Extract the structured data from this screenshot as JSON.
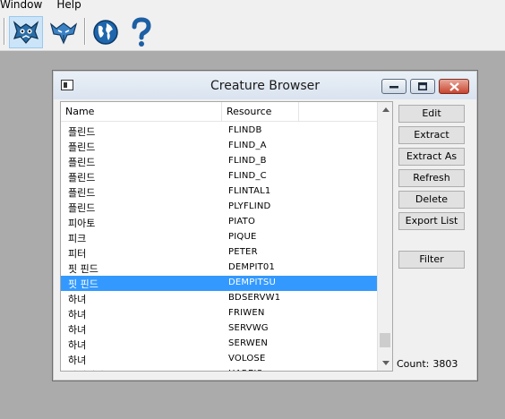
{
  "menu": [
    "Window",
    "Help"
  ],
  "toolbar": {
    "buttons": [
      "creature-icon",
      "batch-creature-icon",
      "globe-icon",
      "help-question-icon"
    ]
  },
  "window": {
    "title": "Creature Browser",
    "columns": [
      "Name",
      "Resource"
    ],
    "rows": [
      {
        "name": "플린드",
        "resource": "FLINDB"
      },
      {
        "name": "플린드",
        "resource": "FLIND_A"
      },
      {
        "name": "플린드",
        "resource": "FLIND_B"
      },
      {
        "name": "플린드",
        "resource": "FLIND_C"
      },
      {
        "name": "플린드",
        "resource": "FLINTAL1"
      },
      {
        "name": "플린드",
        "resource": "PLYFLIND"
      },
      {
        "name": "피아토",
        "resource": "PIATO"
      },
      {
        "name": "피크",
        "resource": "PIQUE"
      },
      {
        "name": "피터",
        "resource": "PETER"
      },
      {
        "name": "핏 핀드",
        "resource": "DEMPIT01"
      },
      {
        "name": "핏 핀드",
        "resource": "DEMPITSU",
        "selected": true
      },
      {
        "name": "하녀",
        "resource": "BDSERVW1"
      },
      {
        "name": "하녀",
        "resource": "FRIWEN"
      },
      {
        "name": "하녀",
        "resource": "SERVWG"
      },
      {
        "name": "하녀",
        "resource": "SERWEN"
      },
      {
        "name": "하녀",
        "resource": "VOLOSE"
      },
      {
        "name": "하레이샤",
        "resource": "HAREIS"
      }
    ],
    "buttons": {
      "edit": "Edit",
      "extract": "Extract",
      "extract_as": "Extract As",
      "refresh": "Refresh",
      "delete": "Delete",
      "export_list": "Export List",
      "filter": "Filter"
    },
    "count_label": "Count:",
    "count_value": "3803"
  },
  "colors": {
    "selection": "#3399ff",
    "annotation_underline": "#d0202a",
    "background": "#ababab"
  }
}
